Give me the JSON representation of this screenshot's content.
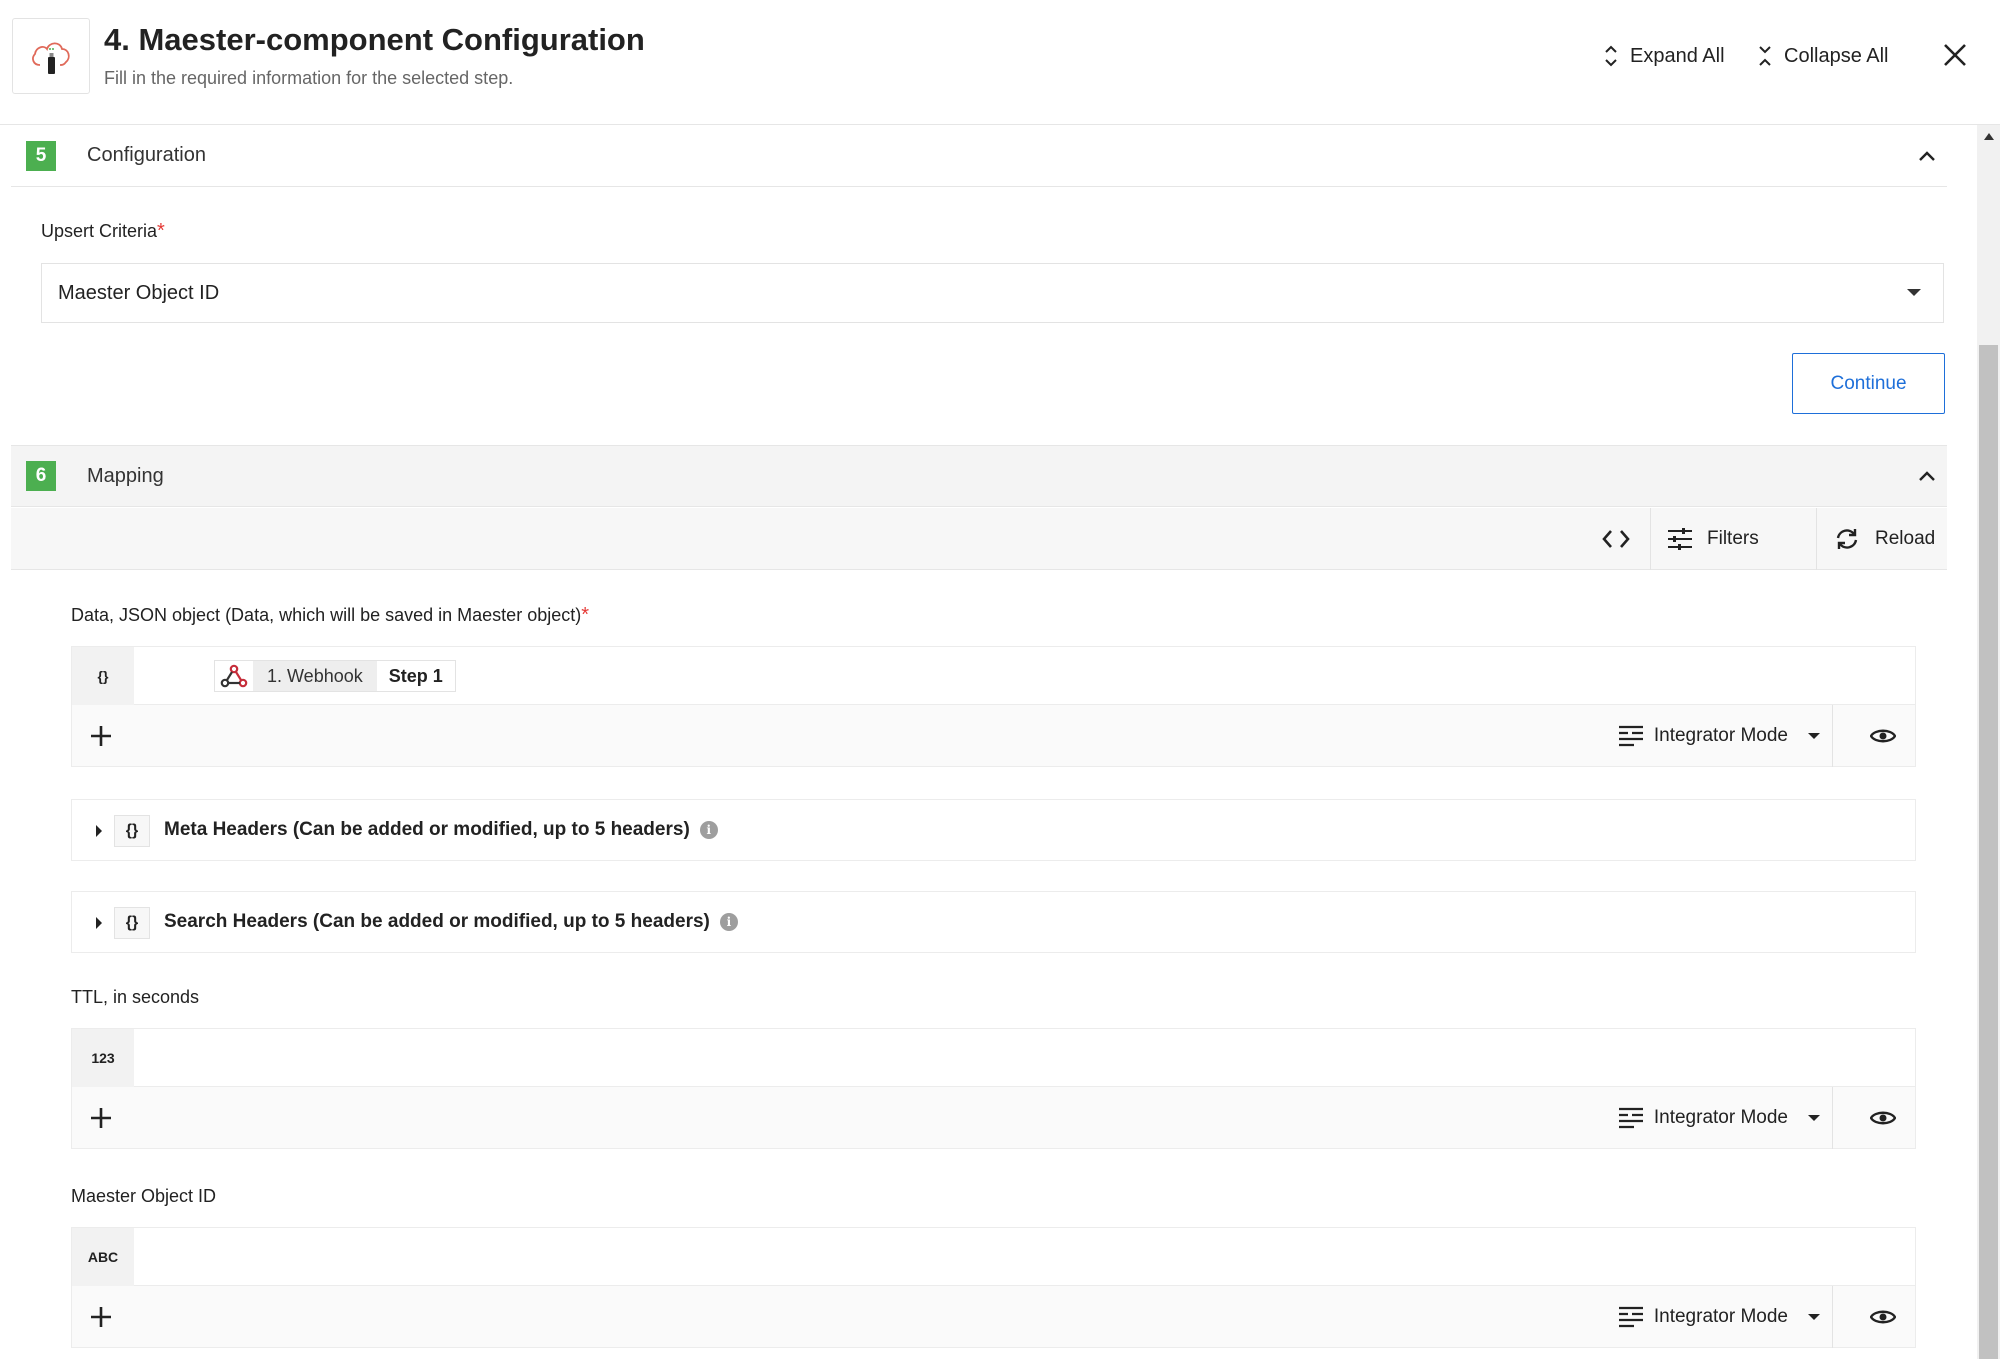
{
  "header": {
    "title": "4. Maester-component Configuration",
    "subtitle": "Fill in the required information for the selected step.",
    "expand_all": "Expand All",
    "collapse_all": "Collapse All"
  },
  "configuration": {
    "step_number": "5",
    "label": "Configuration",
    "upsert_label": "Upsert Criteria",
    "required_mark": "*",
    "upsert_value": "Maester Object ID",
    "continue_label": "Continue"
  },
  "mapping": {
    "step_number": "6",
    "label": "Mapping",
    "toolbar": {
      "filters": "Filters",
      "reload": "Reload"
    },
    "data_field": {
      "label": "Data, JSON object (Data, which will be saved in Maester object)",
      "required_mark": "*",
      "type_badge": "{}",
      "pill_source": "1. Webhook",
      "pill_step": "Step 1",
      "mode": "Integrator Mode"
    },
    "meta_headers": {
      "label": "Meta Headers (Can be added or modified, up to 5 headers)",
      "braces": "{}",
      "info": "i"
    },
    "search_headers": {
      "label": "Search Headers (Can be added or modified, up to 5 headers)",
      "braces": "{}",
      "info": "i"
    },
    "ttl_field": {
      "label": "TTL, in seconds",
      "type_badge": "123",
      "mode": "Integrator Mode"
    },
    "object_id_field": {
      "label": "Maester Object ID",
      "type_badge": "ABC",
      "mode": "Integrator Mode"
    }
  },
  "colors": {
    "accent": "#1e6fd9",
    "step_badge": "#4caf50",
    "required": "#e53935"
  }
}
